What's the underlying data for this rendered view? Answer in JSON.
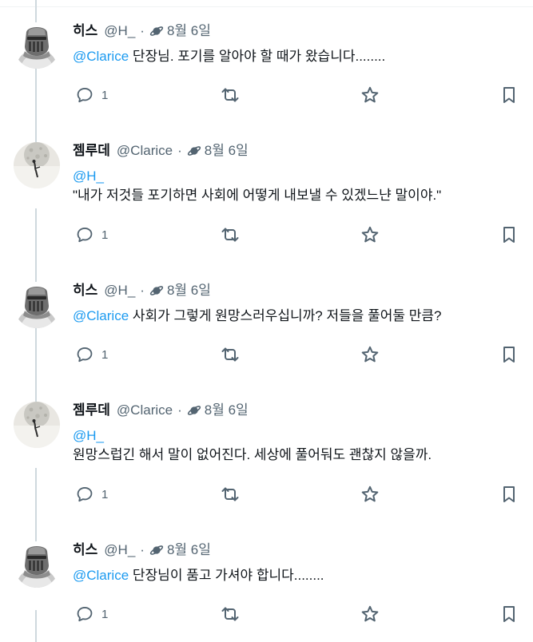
{
  "tweets": [
    {
      "avatar": "knight",
      "name": "히스",
      "handle": "@H_",
      "date": "8월 6일",
      "lines": [
        {
          "mention": "@Clarice",
          "text": " 단장님. 포기를 알아야 할 때가 왔습니다........"
        }
      ],
      "replies": "1"
    },
    {
      "avatar": "moon",
      "name": "젬루데",
      "handle": "@Clarice",
      "date": "8월 6일",
      "lines": [
        {
          "mention": "@H_",
          "text": ""
        },
        {
          "mention": "",
          "text": "\"내가 저것들 포기하면 사회에 어떻게 내보낼 수 있겠느냔 말이야.\""
        }
      ],
      "replies": "1"
    },
    {
      "avatar": "knight",
      "name": "히스",
      "handle": "@H_",
      "date": "8월 6일",
      "lines": [
        {
          "mention": "@Clarice",
          "text": " 사회가 그렇게 원망스러우십니까? 저들을 풀어둘 만큼?"
        }
      ],
      "replies": "1"
    },
    {
      "avatar": "moon",
      "name": "젬루데",
      "handle": "@Clarice",
      "date": "8월 6일",
      "lines": [
        {
          "mention": "@H_",
          "text": ""
        },
        {
          "mention": "",
          "text": "원망스럽긴 해서 말이 없어진다. 세상에 풀어둬도 괜찮지 않을까."
        }
      ],
      "replies": "1"
    },
    {
      "avatar": "knight",
      "name": "히스",
      "handle": "@H_",
      "date": "8월 6일",
      "lines": [
        {
          "mention": "@Clarice",
          "text": " 단장님이 품고 가셔야 합니다........"
        }
      ],
      "replies": "1"
    }
  ],
  "icons": {
    "reply": "speech-bubble-icon",
    "retweet": "retweet-icon",
    "like": "star-icon",
    "bookmark": "bookmark-icon",
    "client": "planet-icon"
  },
  "colors": {
    "mention": "#1d9bf0",
    "secondary_text": "#536471",
    "thread_line": "#cfd9de"
  }
}
